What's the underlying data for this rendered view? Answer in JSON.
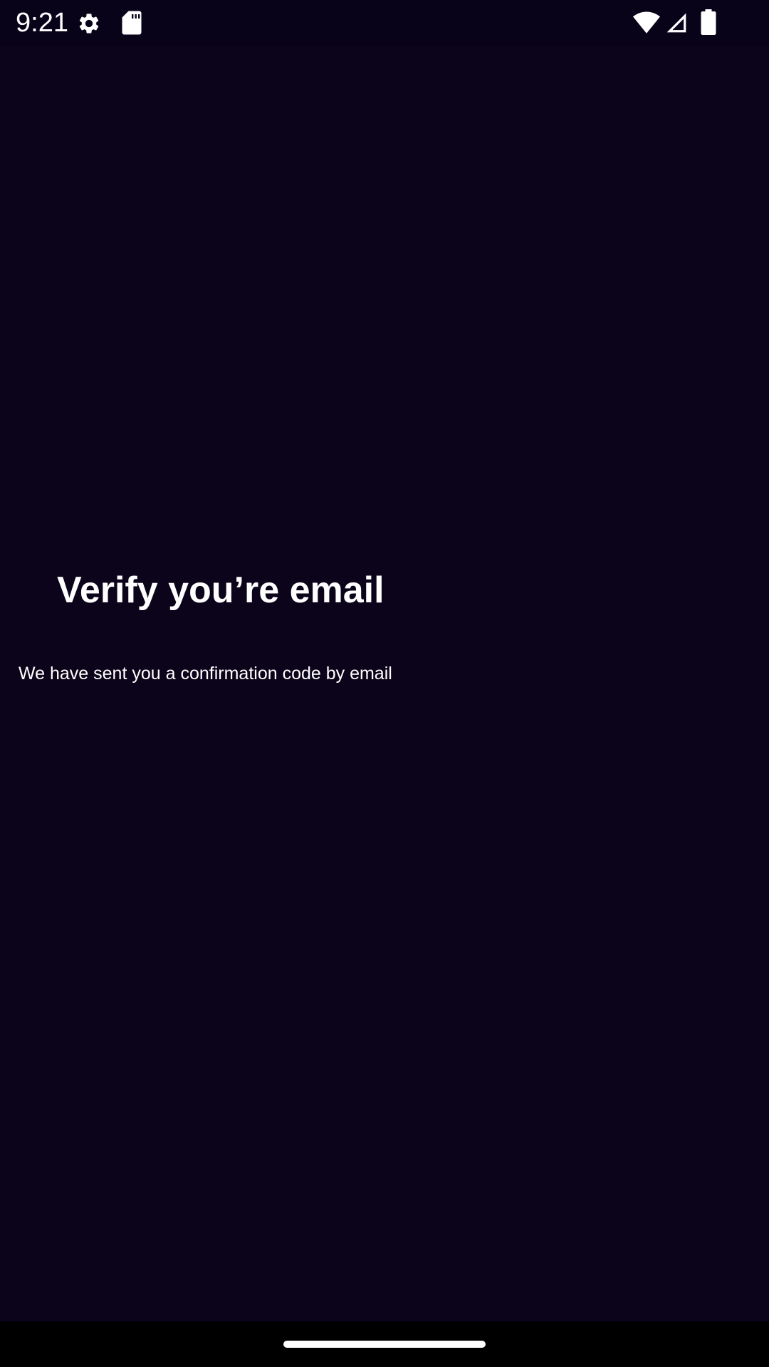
{
  "status_bar": {
    "time": "9:21",
    "icons": [
      "gear-icon",
      "sd-card-icon",
      "wifi-icon",
      "cellular-signal-icon",
      "battery-icon"
    ]
  },
  "content": {
    "title": "Verify you’re email",
    "subtitle": "We have sent you a confirmation code by email"
  },
  "colors": {
    "background": "#0c041a",
    "status_bar": "#09031a",
    "text": "#ffffff",
    "nav_bar": "#000000"
  }
}
